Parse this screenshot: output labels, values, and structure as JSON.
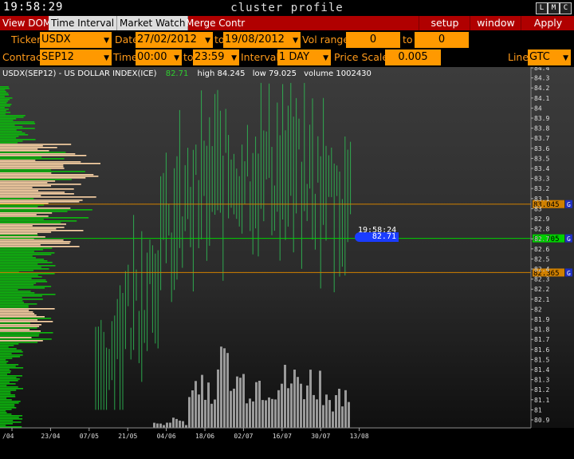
{
  "window": {
    "clock": "19:58:29",
    "title": "cluster profile",
    "btn_l": "L",
    "btn_m": "M",
    "btn_c": "C"
  },
  "menubar": {
    "items": [
      "View DOM",
      "Time Interval",
      "Market Watch",
      "Merge Contr"
    ],
    "setup": "setup",
    "window": "window",
    "apply": "Apply"
  },
  "row1": {
    "ticker_label": "Ticker",
    "ticker": "USDX",
    "date_label": "Date",
    "date_from": "27/02/2012",
    "to1": "to",
    "date_to": "19/08/2012",
    "vol_label": "Vol range",
    "vol_from": "0",
    "to2": "to",
    "vol_to": "0"
  },
  "row2": {
    "contract_label": "Contract",
    "contract": "SEP12",
    "time_label": "Time",
    "time_from": "00:00",
    "to": "to",
    "time_to": "23:59",
    "interval_label": "Interval",
    "interval": "1 DAY",
    "price_scale_label": "Price Scale",
    "price_scale": "0.005",
    "line_label": "Line",
    "line": "GTC"
  },
  "chart": {
    "header": "USDX(SEP12) - US DOLLAR INDEX(ICE)",
    "last": "82.71",
    "high": "high 84.245",
    "low": "low 79.025",
    "volume": "volume 1002430",
    "cursor_time": "19:58:24",
    "cursor_price": "82.71",
    "cursor_line_label": "82.705",
    "level_upper": "83.045",
    "level_lower": "82.365",
    "level_tag": "G",
    "price_ticks": [
      "84.4",
      "84.3",
      "84.2",
      "84.1",
      "84",
      "83.9",
      "83.8",
      "83.7",
      "83.6",
      "83.5",
      "83.4",
      "83.3",
      "83.2",
      "83.1",
      "83",
      "82.9",
      "82.8",
      "82.7",
      "82.6",
      "82.5",
      "82.4",
      "82.3",
      "82.2",
      "82.1",
      "82",
      "81.9",
      "81.8",
      "81.7",
      "81.6",
      "81.5",
      "81.4",
      "81.3",
      "81.2",
      "81.1",
      "81",
      "80.9"
    ],
    "date_ticks": [
      "/04",
      "23/04",
      "07/05",
      "21/05",
      "04/06",
      "18/06",
      "02/07",
      "16/07",
      "30/07",
      "13/08"
    ],
    "colors": {
      "profile_green": "#0db80d",
      "profile_peach": "#ffd6a8",
      "candle": "#2fbf55",
      "volume": "#9a9a9a",
      "level": "#d08000",
      "cursor": "#00d000",
      "price_tag": "#1a3cff"
    }
  }
}
